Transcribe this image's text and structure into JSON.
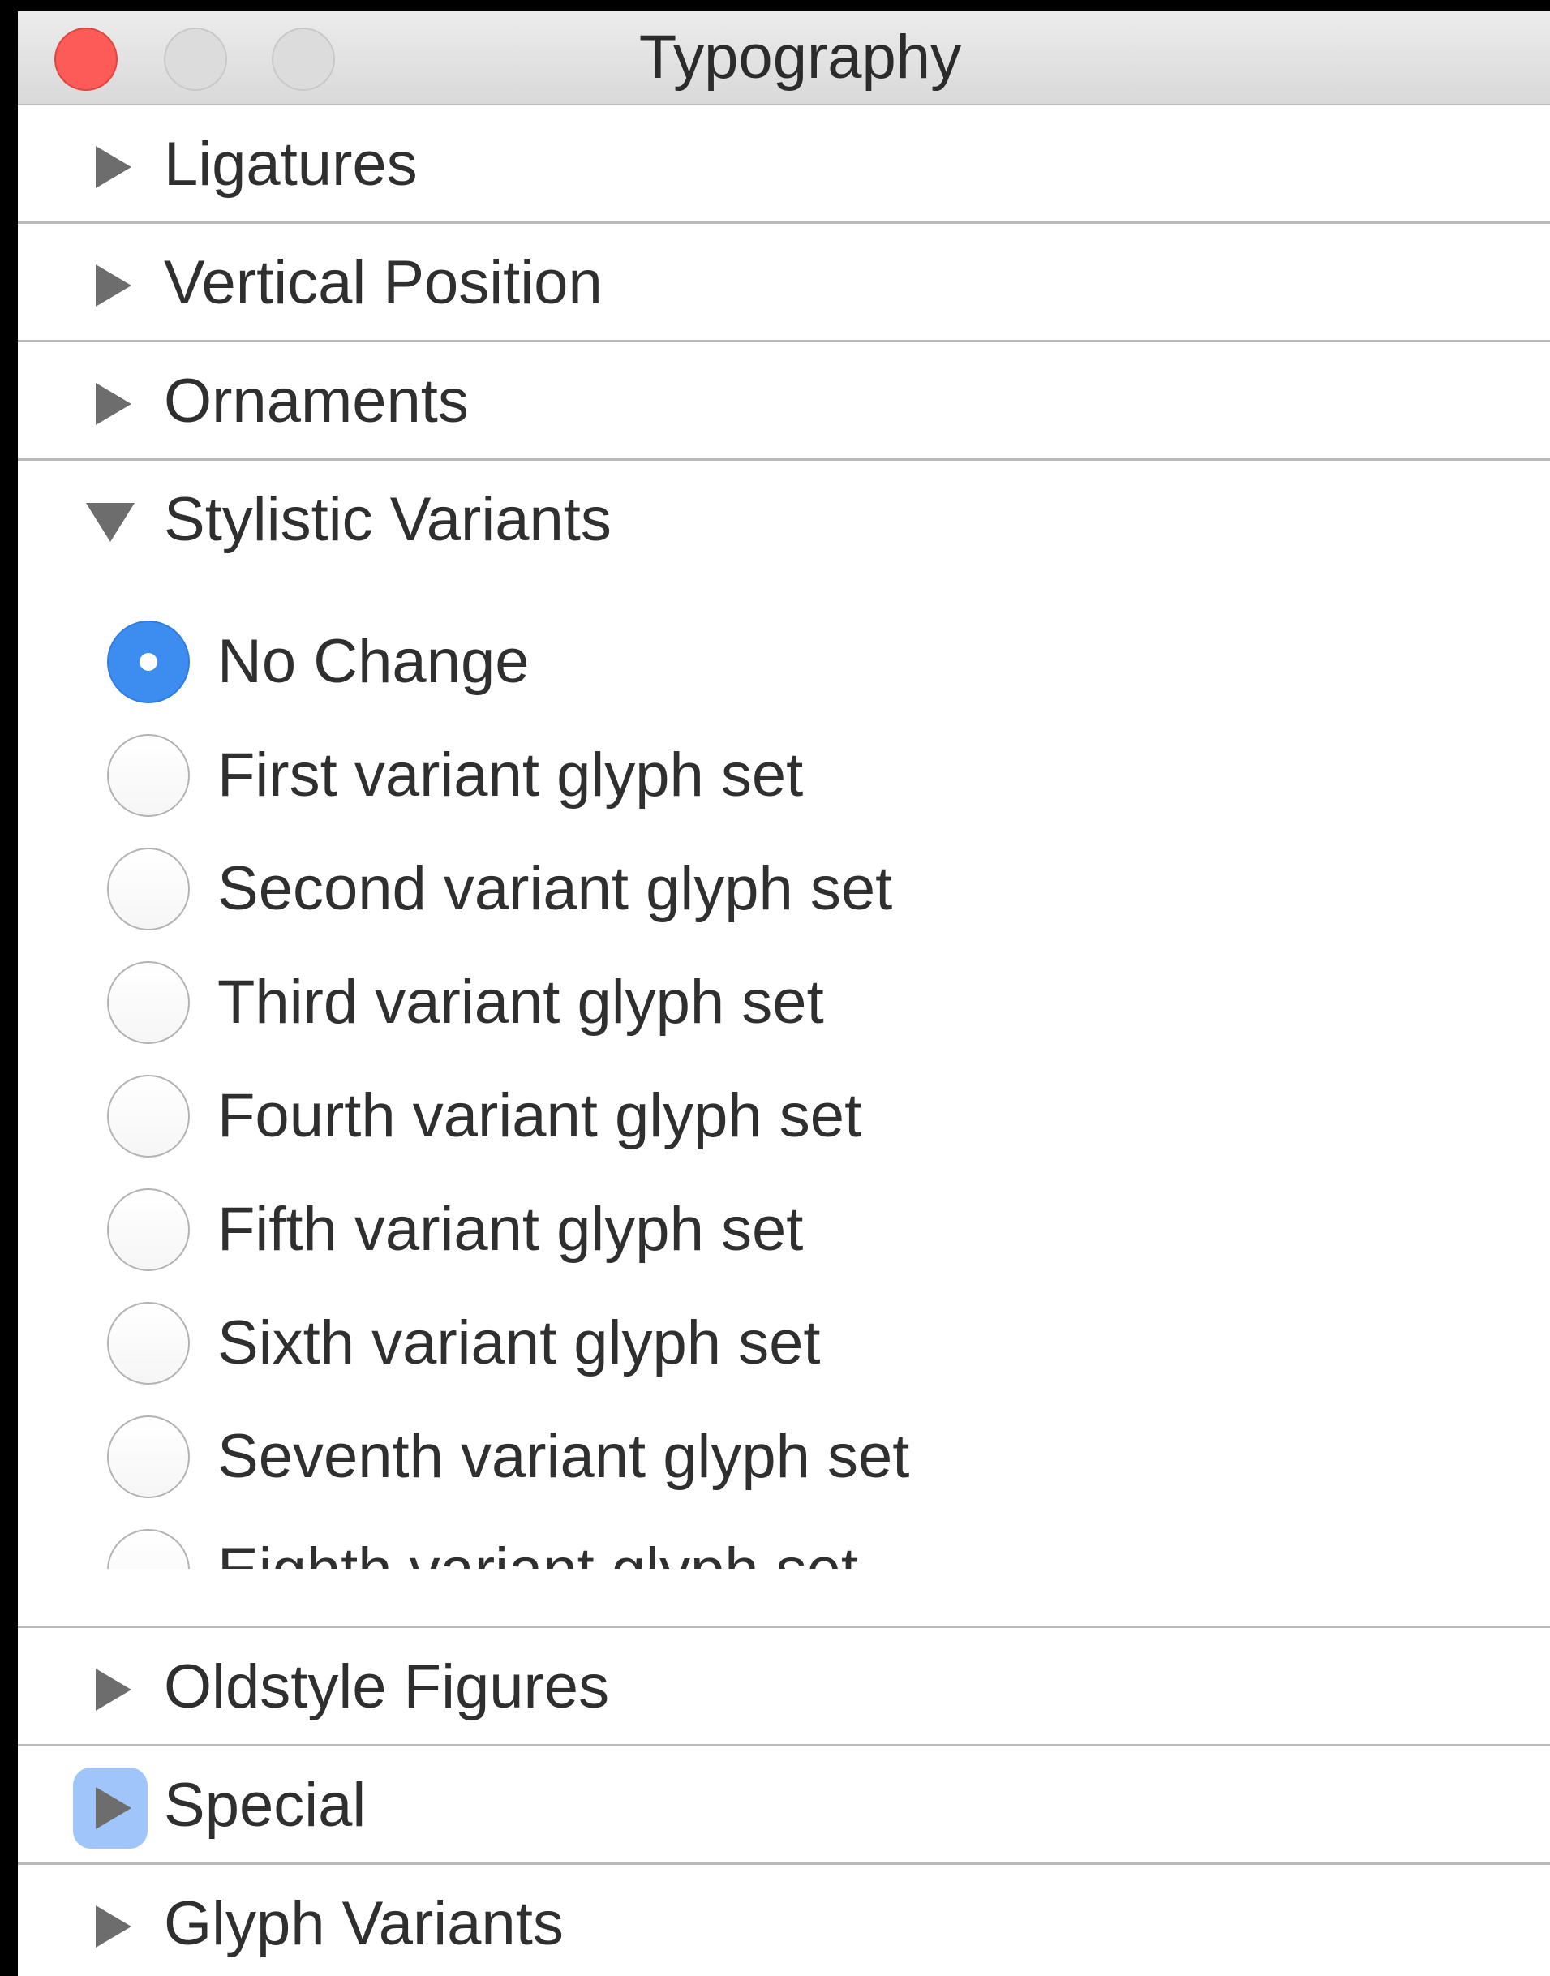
{
  "window": {
    "title": "Typography"
  },
  "sections": {
    "ligatures": "Ligatures",
    "vertical_position": "Vertical Position",
    "ornaments": "Ornaments",
    "stylistic_variants": "Stylistic Variants",
    "oldstyle_figures": "Oldstyle Figures",
    "special": "Special",
    "glyph_variants": "Glyph Variants"
  },
  "stylistic_variants": {
    "selected": "No Change",
    "options": [
      "No Change",
      "First variant glyph set",
      "Second variant glyph set",
      "Third variant glyph set",
      "Fourth variant glyph set",
      "Fifth variant glyph set",
      "Sixth variant glyph set",
      "Seventh variant glyph set",
      "Eighth variant glyph set"
    ]
  },
  "colors": {
    "accent": "#3d8df0",
    "close_button": "#fc5b57",
    "focus_ring": "#5096f5"
  },
  "icons": {
    "collapsed": "disclosure-triangle-right-icon",
    "expanded": "disclosure-triangle-down-icon"
  }
}
